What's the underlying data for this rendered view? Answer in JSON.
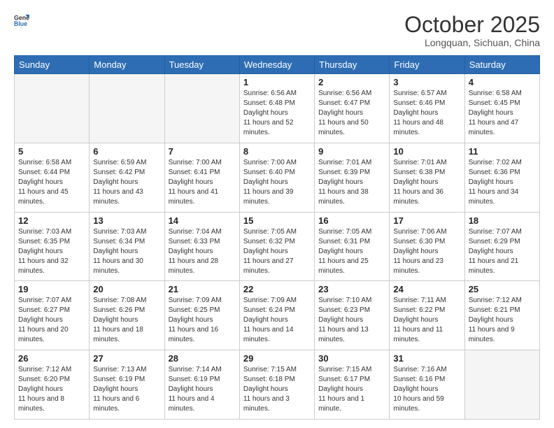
{
  "logo": {
    "general": "General",
    "blue": "Blue"
  },
  "header": {
    "month": "October 2025",
    "location": "Longquan, Sichuan, China"
  },
  "weekdays": [
    "Sunday",
    "Monday",
    "Tuesday",
    "Wednesday",
    "Thursday",
    "Friday",
    "Saturday"
  ],
  "weeks": [
    [
      {
        "day": "",
        "empty": true
      },
      {
        "day": "",
        "empty": true
      },
      {
        "day": "",
        "empty": true
      },
      {
        "day": "1",
        "rise": "6:56 AM",
        "set": "6:48 PM",
        "daylight": "11 hours and 52 minutes."
      },
      {
        "day": "2",
        "rise": "6:56 AM",
        "set": "6:47 PM",
        "daylight": "11 hours and 50 minutes."
      },
      {
        "day": "3",
        "rise": "6:57 AM",
        "set": "6:46 PM",
        "daylight": "11 hours and 48 minutes."
      },
      {
        "day": "4",
        "rise": "6:58 AM",
        "set": "6:45 PM",
        "daylight": "11 hours and 47 minutes."
      }
    ],
    [
      {
        "day": "5",
        "rise": "6:58 AM",
        "set": "6:44 PM",
        "daylight": "11 hours and 45 minutes."
      },
      {
        "day": "6",
        "rise": "6:59 AM",
        "set": "6:42 PM",
        "daylight": "11 hours and 43 minutes."
      },
      {
        "day": "7",
        "rise": "7:00 AM",
        "set": "6:41 PM",
        "daylight": "11 hours and 41 minutes."
      },
      {
        "day": "8",
        "rise": "7:00 AM",
        "set": "6:40 PM",
        "daylight": "11 hours and 39 minutes."
      },
      {
        "day": "9",
        "rise": "7:01 AM",
        "set": "6:39 PM",
        "daylight": "11 hours and 38 minutes."
      },
      {
        "day": "10",
        "rise": "7:01 AM",
        "set": "6:38 PM",
        "daylight": "11 hours and 36 minutes."
      },
      {
        "day": "11",
        "rise": "7:02 AM",
        "set": "6:36 PM",
        "daylight": "11 hours and 34 minutes."
      }
    ],
    [
      {
        "day": "12",
        "rise": "7:03 AM",
        "set": "6:35 PM",
        "daylight": "11 hours and 32 minutes."
      },
      {
        "day": "13",
        "rise": "7:03 AM",
        "set": "6:34 PM",
        "daylight": "11 hours and 30 minutes."
      },
      {
        "day": "14",
        "rise": "7:04 AM",
        "set": "6:33 PM",
        "daylight": "11 hours and 28 minutes."
      },
      {
        "day": "15",
        "rise": "7:05 AM",
        "set": "6:32 PM",
        "daylight": "11 hours and 27 minutes."
      },
      {
        "day": "16",
        "rise": "7:05 AM",
        "set": "6:31 PM",
        "daylight": "11 hours and 25 minutes."
      },
      {
        "day": "17",
        "rise": "7:06 AM",
        "set": "6:30 PM",
        "daylight": "11 hours and 23 minutes."
      },
      {
        "day": "18",
        "rise": "7:07 AM",
        "set": "6:29 PM",
        "daylight": "11 hours and 21 minutes."
      }
    ],
    [
      {
        "day": "19",
        "rise": "7:07 AM",
        "set": "6:27 PM",
        "daylight": "11 hours and 20 minutes."
      },
      {
        "day": "20",
        "rise": "7:08 AM",
        "set": "6:26 PM",
        "daylight": "11 hours and 18 minutes."
      },
      {
        "day": "21",
        "rise": "7:09 AM",
        "set": "6:25 PM",
        "daylight": "11 hours and 16 minutes."
      },
      {
        "day": "22",
        "rise": "7:09 AM",
        "set": "6:24 PM",
        "daylight": "11 hours and 14 minutes."
      },
      {
        "day": "23",
        "rise": "7:10 AM",
        "set": "6:23 PM",
        "daylight": "11 hours and 13 minutes."
      },
      {
        "day": "24",
        "rise": "7:11 AM",
        "set": "6:22 PM",
        "daylight": "11 hours and 11 minutes."
      },
      {
        "day": "25",
        "rise": "7:12 AM",
        "set": "6:21 PM",
        "daylight": "11 hours and 9 minutes."
      }
    ],
    [
      {
        "day": "26",
        "rise": "7:12 AM",
        "set": "6:20 PM",
        "daylight": "11 hours and 8 minutes."
      },
      {
        "day": "27",
        "rise": "7:13 AM",
        "set": "6:19 PM",
        "daylight": "11 hours and 6 minutes."
      },
      {
        "day": "28",
        "rise": "7:14 AM",
        "set": "6:19 PM",
        "daylight": "11 hours and 4 minutes."
      },
      {
        "day": "29",
        "rise": "7:15 AM",
        "set": "6:18 PM",
        "daylight": "11 hours and 3 minutes."
      },
      {
        "day": "30",
        "rise": "7:15 AM",
        "set": "6:17 PM",
        "daylight": "11 hours and 1 minute."
      },
      {
        "day": "31",
        "rise": "7:16 AM",
        "set": "6:16 PM",
        "daylight": "10 hours and 59 minutes."
      },
      {
        "day": "",
        "empty": true
      }
    ]
  ]
}
